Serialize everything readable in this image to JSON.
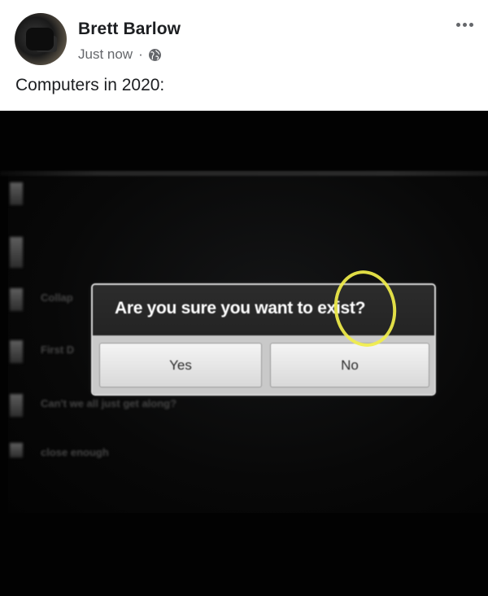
{
  "post": {
    "author": "Brett Barlow",
    "time": "Just now",
    "separator": "·",
    "privacy_icon": "globe-icon",
    "more_icon": "more-options-icon",
    "text": "Computers in 2020:"
  },
  "photo": {
    "background_list": [
      {
        "title": "",
        "sub": ""
      },
      {
        "title": "",
        "sub": ""
      },
      {
        "title": "Collap",
        "sub": ""
      },
      {
        "title": "First D",
        "sub": ""
      },
      {
        "title": "Can't we all just get along?",
        "sub": ""
      },
      {
        "title": "close enough",
        "sub": ""
      }
    ],
    "dialog": {
      "title": "Are you sure you want to exist?",
      "buttons": {
        "yes": "Yes",
        "no": "No"
      }
    },
    "annotation_color": "#f1ee4a"
  }
}
